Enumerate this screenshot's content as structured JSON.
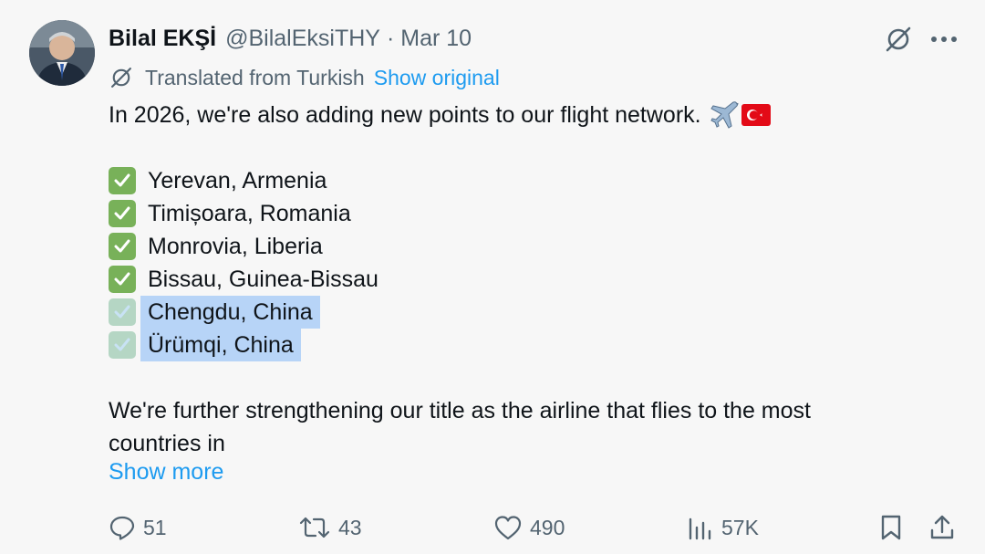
{
  "author": {
    "display_name": "Bilal EKŞİ",
    "handle": "@BilalEksiTHY",
    "separator": "·",
    "date": "Mar 10"
  },
  "translation": {
    "label": "Translated from Turkish",
    "show_original": "Show original"
  },
  "tweet": {
    "intro": "In 2026, we're also adding new points to our flight network.",
    "intro_emojis": [
      "airplane-icon",
      "turkey-flag-icon"
    ],
    "destinations": [
      {
        "name": "Yerevan, Armenia",
        "selected": false
      },
      {
        "name": "Timișoara, Romania",
        "selected": false
      },
      {
        "name": "Monrovia, Liberia",
        "selected": false
      },
      {
        "name": "Bissau, Guinea-Bissau",
        "selected": false
      },
      {
        "name": "Chengdu, China",
        "selected": true
      },
      {
        "name": "Ürümqi, China",
        "selected": true
      }
    ],
    "closing_line_1": "We're further strengthening our title as the airline that flies to the most",
    "closing_line_2": "countries in",
    "show_more": "Show more"
  },
  "actions": {
    "replies": "51",
    "reposts": "43",
    "likes": "490",
    "views": "57K"
  },
  "colors": {
    "link": "#1d9bf0",
    "muted": "#536471",
    "text": "#0f1419",
    "check": "#78b159",
    "selection": "#b7d4f7"
  }
}
